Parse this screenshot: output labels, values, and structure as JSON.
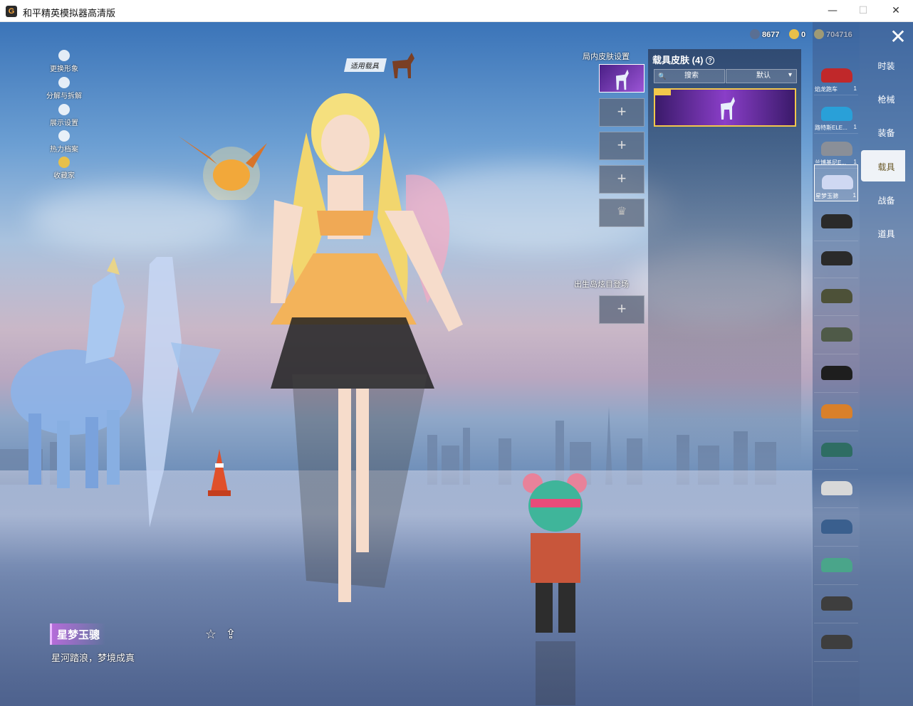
{
  "window": {
    "title": "和平精英模拟器高清版",
    "app_icon": "G",
    "minimize": "—",
    "maximize": "☐",
    "close": "✕"
  },
  "left_menu": [
    {
      "label": "更换形象",
      "icon": "person-icon"
    },
    {
      "label": "分解与拆解",
      "icon": "puzzle-icon"
    },
    {
      "label": "展示设置",
      "icon": "eye-icon"
    },
    {
      "label": "热力档案",
      "icon": "flame-icon"
    },
    {
      "label": "收藏家",
      "icon": "trophy-icon"
    }
  ],
  "currency": {
    "a": "8677",
    "b": "0",
    "c": "704716"
  },
  "categories": [
    "时装",
    "枪械",
    "装备",
    "载具",
    "战备",
    "道具"
  ],
  "active_category": "载具",
  "close_label": "✕",
  "vehicles": [
    {
      "name": "焰龙跑车",
      "count": "1",
      "color": "#c0282a"
    },
    {
      "name": "路特斯ELE...",
      "count": "1",
      "color": "#29a0d8"
    },
    {
      "name": "兰博基尼E...",
      "count": "1",
      "color": "#8a8f98"
    },
    {
      "name": "星梦玉骢",
      "count": "1",
      "color": "#cfd8f2"
    },
    {
      "name": "",
      "count": "",
      "color": "#2a2a2a"
    },
    {
      "name": "",
      "count": "",
      "color": "#2a2a2a"
    },
    {
      "name": "",
      "count": "",
      "color": "#4d5138"
    },
    {
      "name": "",
      "count": "",
      "color": "#4f5a48"
    },
    {
      "name": "",
      "count": "",
      "color": "#1e1e1e"
    },
    {
      "name": "",
      "count": "",
      "color": "#d9802a"
    },
    {
      "name": "",
      "count": "",
      "color": "#2e6d63"
    },
    {
      "name": "",
      "count": "",
      "color": "#d8d8d8"
    },
    {
      "name": "",
      "count": "",
      "color": "#3a5f8e"
    },
    {
      "name": "",
      "count": "",
      "color": "#4aa58a"
    },
    {
      "name": "",
      "count": "",
      "color": "#3e3e3e"
    },
    {
      "name": "",
      "count": "",
      "color": "#3e3e3e"
    }
  ],
  "skin_panel": {
    "title": "载具皮肤 (4)",
    "help": "?",
    "search_placeholder": "搜索",
    "sort": "默认",
    "search_icon": "🔍",
    "chevron": "▾"
  },
  "slots": {
    "header": "局内皮肤设置",
    "spawn_header": "出生岛炫目登场",
    "plus": "+",
    "crown": "♛"
  },
  "mount_tag": "适用载具",
  "item": {
    "name": "星梦玉骢",
    "desc": "星河踏浪，梦境成真"
  },
  "actions": {
    "favorite": "☆",
    "share": "⇪"
  },
  "colors": {
    "accent_purple": "#9c55d6",
    "gold": "#f3c84b"
  }
}
